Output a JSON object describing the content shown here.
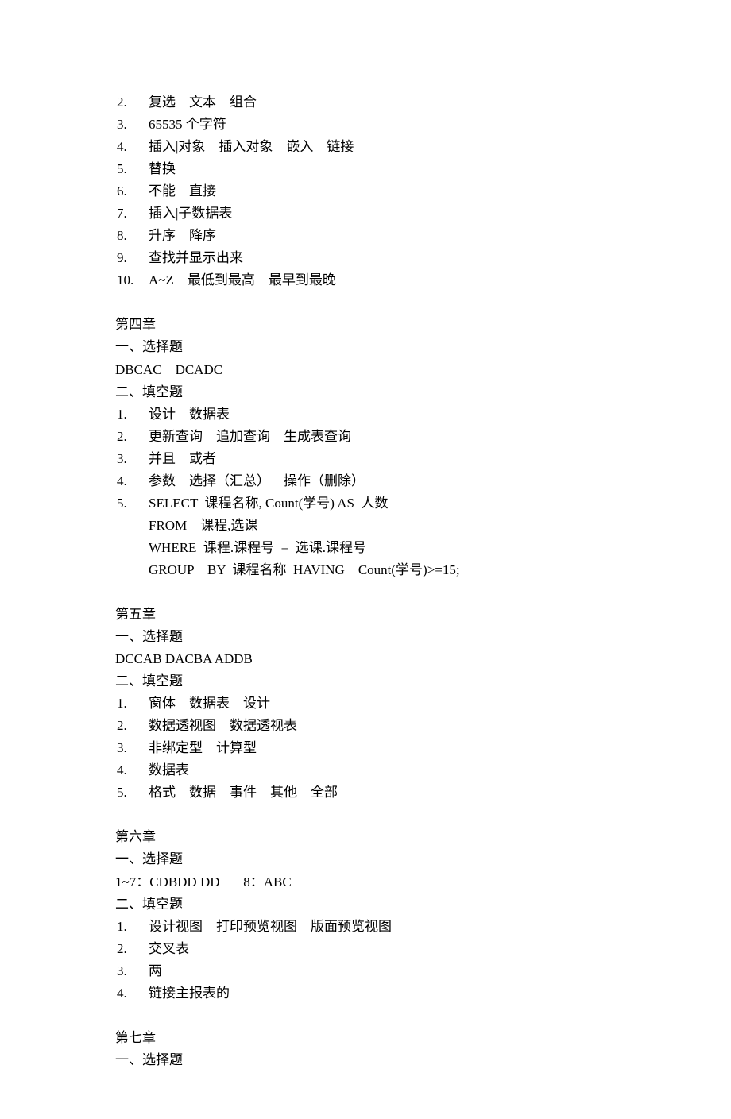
{
  "chapter3_fill": [
    {
      "num": "2.",
      "text": "复选    文本    组合"
    },
    {
      "num": "3.",
      "text": "65535 个字符"
    },
    {
      "num": "4.",
      "text": "插入|对象    插入对象    嵌入    链接"
    },
    {
      "num": "5.",
      "text": "替换"
    },
    {
      "num": "6.",
      "text": "不能    直接"
    },
    {
      "num": "7.",
      "text": "插入|子数据表"
    },
    {
      "num": "8.",
      "text": "升序    降序"
    },
    {
      "num": "9.",
      "text": "查找并显示出来"
    },
    {
      "num": "10.",
      "text": "A~Z    最低到最高    最早到最晚"
    }
  ],
  "chapter4": {
    "title": "第四章",
    "choice_header": "一、选择题",
    "choice_answers": "DBCAC    DCADC",
    "fill_header": "二、填空题",
    "fill": [
      {
        "num": "1.",
        "text": "设计    数据表"
      },
      {
        "num": "2.",
        "text": "更新查询    追加查询    生成表查询"
      },
      {
        "num": "3.",
        "text": "并且    或者"
      },
      {
        "num": "4.",
        "text": "参数    选择（汇总）    操作（删除）"
      },
      {
        "num": "5.",
        "text": "SELECT  课程名称, Count(学号) AS  人数"
      }
    ],
    "sql": [
      "FROM    课程,选课",
      "WHERE  课程.课程号  =  选课.课程号",
      "GROUP    BY  课程名称  HAVING    Count(学号)>=15;"
    ]
  },
  "chapter5": {
    "title": "第五章",
    "choice_header": "一、选择题",
    "choice_answers": "DCCAB DACBA ADDB",
    "fill_header": "二、填空题",
    "fill": [
      {
        "num": "1.",
        "text": "窗体    数据表    设计"
      },
      {
        "num": "2.",
        "text": "数据透视图    数据透视表"
      },
      {
        "num": "3.",
        "text": "非绑定型    计算型"
      },
      {
        "num": "4.",
        "text": "数据表"
      },
      {
        "num": "5.",
        "text": "格式    数据    事件    其他    全部"
      }
    ]
  },
  "chapter6": {
    "title": "第六章",
    "choice_header": "一、选择题",
    "choice_answers": "1~7：CDBDD DD       8：ABC",
    "fill_header": "二、填空题",
    "fill": [
      {
        "num": "1.",
        "text": "设计视图    打印预览视图    版面预览视图"
      },
      {
        "num": "2.",
        "text": "交叉表"
      },
      {
        "num": "3.",
        "text": "两"
      },
      {
        "num": "4.",
        "text": "链接主报表的"
      }
    ]
  },
  "chapter7": {
    "title": "第七章",
    "choice_header": "一、选择题"
  }
}
